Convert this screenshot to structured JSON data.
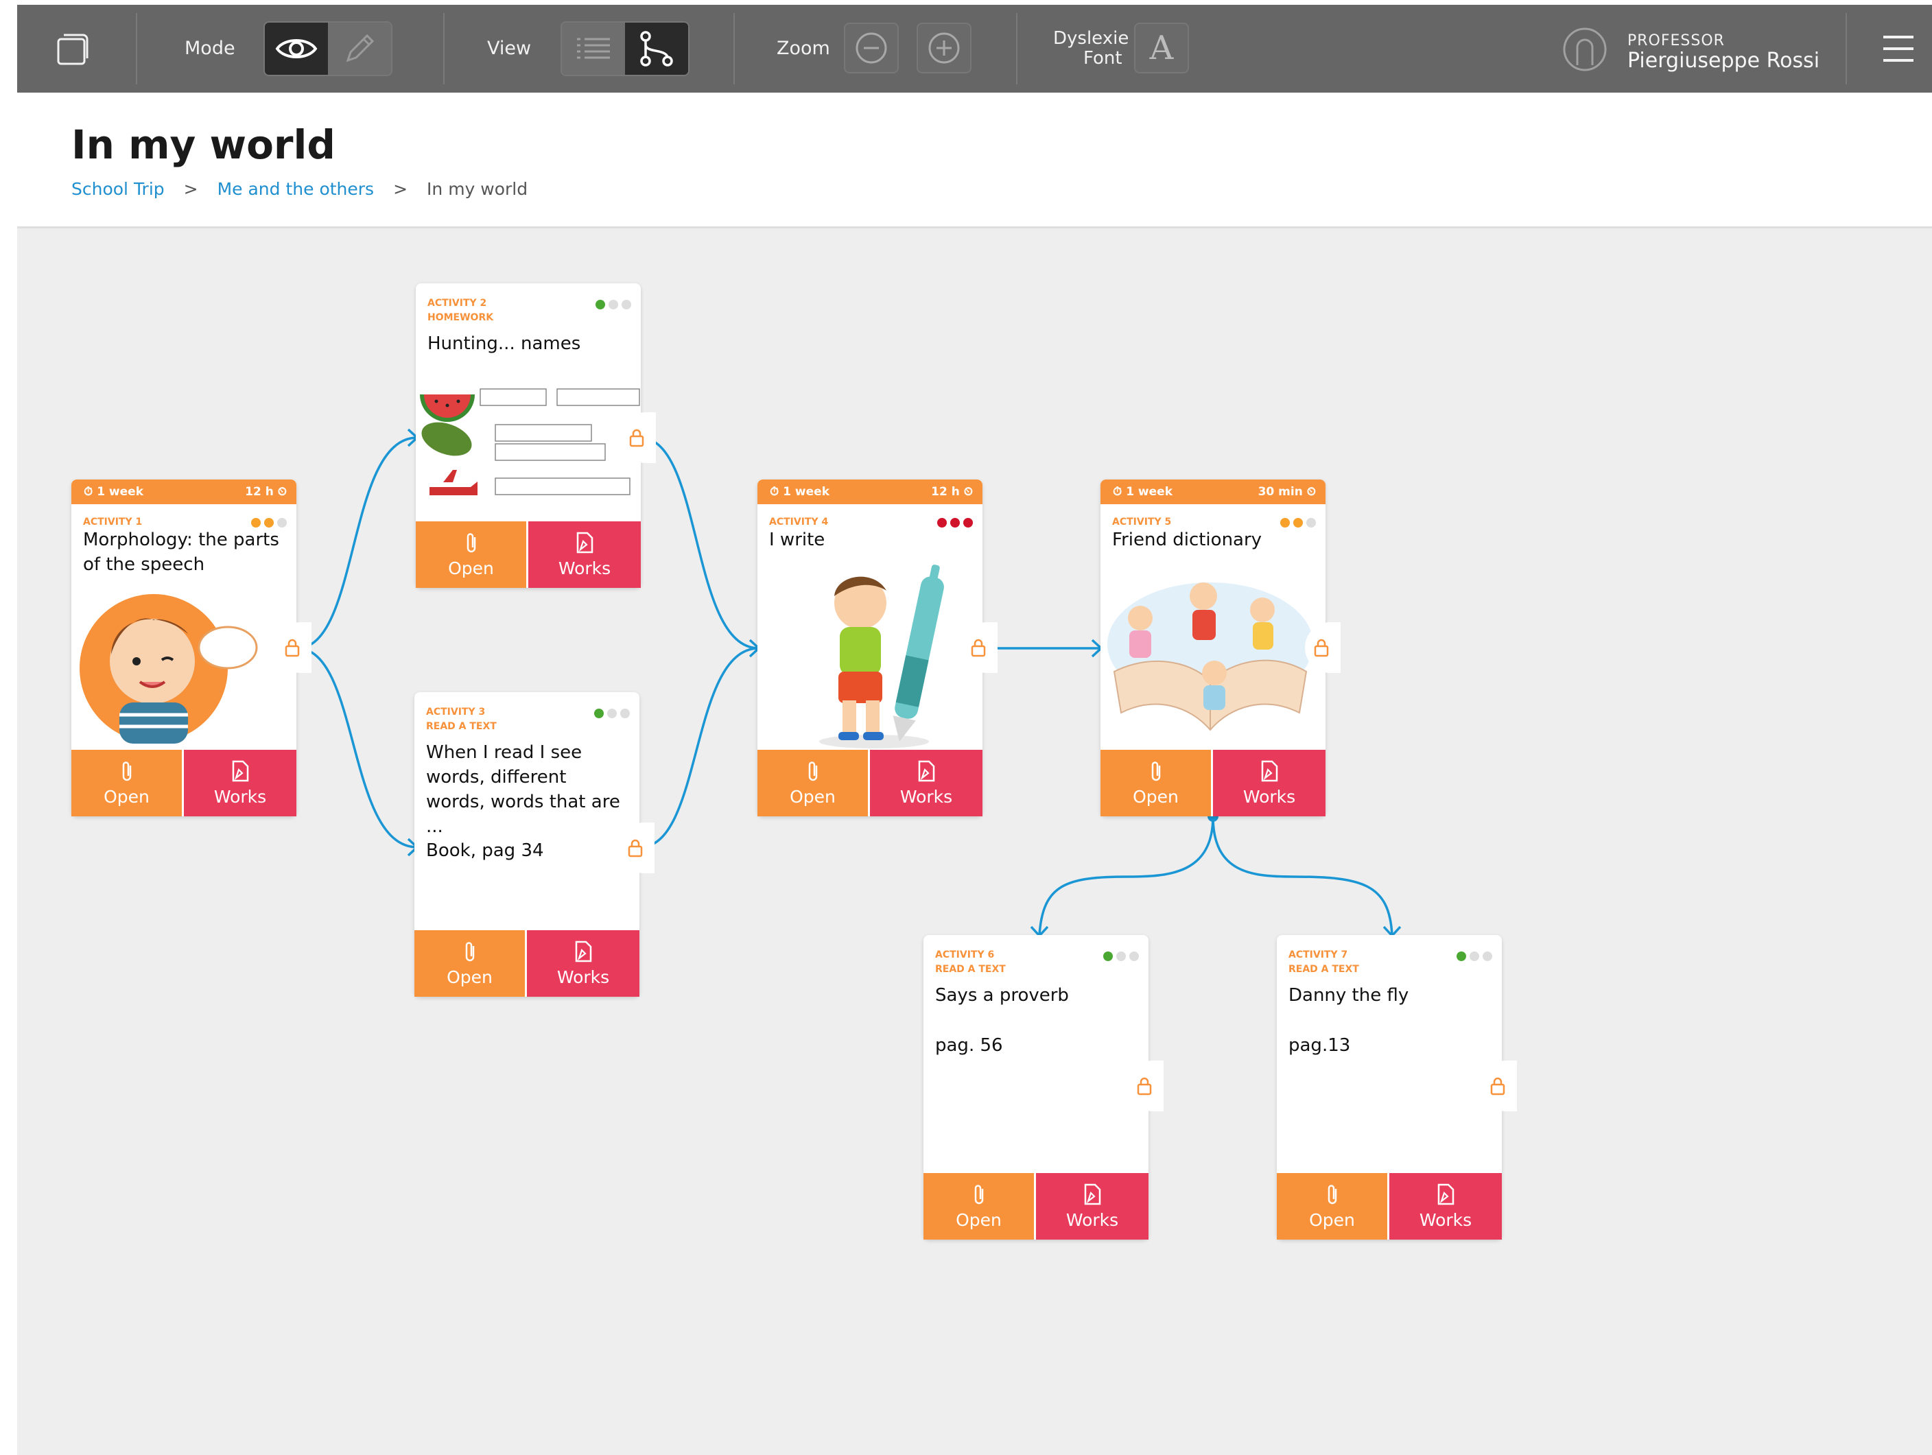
{
  "toolbar": {
    "mode_label": "Mode",
    "view_label": "View",
    "zoom_label": "Zoom",
    "font_label_1": "Dyslexie",
    "font_label_2": "Font",
    "font_button_glyph": "A",
    "professor_role": "PROFESSOR",
    "professor_name": "Piergiuseppe Rossi",
    "icons": [
      "folder-icon",
      "eye-icon",
      "pencil-icon",
      "list-view-icon",
      "graph-view-icon",
      "zoom-out-icon",
      "zoom-in-icon",
      "user-avatar-icon",
      "hamburger-menu-icon"
    ]
  },
  "header": {
    "title": "In my world",
    "breadcrumb": [
      {
        "label": "School Trip",
        "link": true
      },
      {
        "label": "Me and the others",
        "link": true
      },
      {
        "label": "In my world",
        "link": false
      }
    ],
    "separator": ">"
  },
  "colors": {
    "toolbar_bg": "#666666",
    "accent_orange": "#f7913a",
    "works_red": "#e83a5a",
    "link_blue": "#1f8fd0",
    "connector_blue": "#1b96d4",
    "dot_green": "#4aa832",
    "dot_orange": "#f7a12a",
    "dot_red": "#d0122a",
    "dot_grey": "#dddddd"
  },
  "cards": {
    "a1": {
      "duration": "1 week",
      "time": "12 h",
      "kicker": "ACTIVITY 1",
      "title": "Morphology: the parts of the speech",
      "dots": [
        "orange",
        "orange",
        "grey"
      ],
      "open": "Open",
      "works": "Works"
    },
    "a2": {
      "kicker1": "ACTIVITY 2",
      "kicker2": "HOMEWORK",
      "title": "Hunting... names",
      "dots": [
        "green",
        "grey",
        "grey"
      ],
      "open": "Open",
      "works": "Works"
    },
    "a3": {
      "kicker1": "ACTIVITY 3",
      "kicker2": "READ A TEXT",
      "title": "When I read I see words, different words, words that are ...",
      "note": "Book, pag 34",
      "dots": [
        "green",
        "grey",
        "grey"
      ],
      "open": "Open",
      "works": "Works"
    },
    "a4": {
      "duration": "1 week",
      "time": "12 h",
      "kicker": "ACTIVITY 4",
      "title": "I write",
      "dots": [
        "red",
        "red",
        "red"
      ],
      "open": "Open",
      "works": "Works"
    },
    "a5": {
      "duration": "1 week",
      "time": "30 min",
      "kicker": "ACTIVITY 5",
      "title": "Friend dictionary",
      "dots": [
        "orange",
        "orange",
        "grey"
      ],
      "open": "Open",
      "works": "Works"
    },
    "a6": {
      "kicker1": "ACTIVITY 6",
      "kicker2": "READ A TEXT",
      "title": "Says a proverb",
      "note": "pag. 56",
      "dots": [
        "green",
        "grey",
        "grey"
      ],
      "open": "Open",
      "works": "Works"
    },
    "a7": {
      "kicker1": "ACTIVITY 7",
      "kicker2": "READ A TEXT",
      "title": "Danny the fly",
      "note": "pag.13",
      "dots": [
        "green",
        "grey",
        "grey"
      ],
      "open": "Open",
      "works": "Works"
    }
  }
}
